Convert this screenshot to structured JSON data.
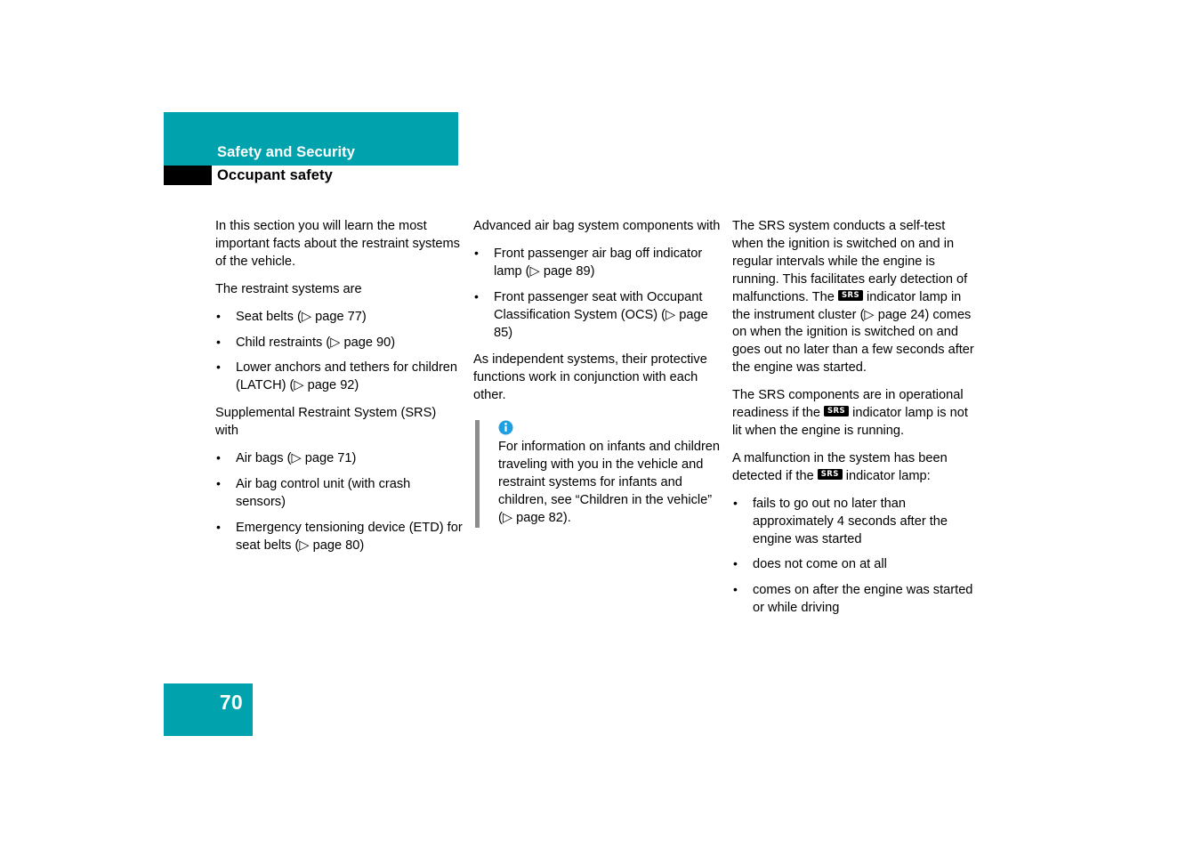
{
  "header": {
    "chapter_title": "Safety and Security",
    "section_title": "Occupant safety",
    "band_color": "#00a3ad",
    "marker_color": "#000000"
  },
  "columns": {
    "col1": {
      "intro_paragraph": "In this section you will learn the most important facts about the restraint systems of the vehicle.",
      "lead_1": "The restraint systems are",
      "list_1": [
        "Seat belts (▷ page 77)",
        "Child restraints (▷ page 90)",
        "Lower anchors and tethers for children (LATCH) (▷ page 92)"
      ],
      "lead_2": "Supplemental Restraint System (SRS) with",
      "list_2": [
        "Air bags (▷ page 71)",
        "Air bag control unit (with crash sensors)",
        "Emergency tensioning device (ETD) for seat belts (▷ page 80)"
      ]
    },
    "col2": {
      "lead_1": "Advanced air bag system components with",
      "list_1": [
        "Front passenger air bag off indicator lamp (▷ page 89)",
        "Front passenger seat with Occupant Classification System (OCS) (▷ page 85)"
      ],
      "para_1": "As independent systems, their protective functions work in conjunction with each other.",
      "note": {
        "icon": "info-circle-icon",
        "icon_color": "#1f9fe0",
        "rule_color": "#8c8c8c",
        "text": "For information on infants and children traveling with you in the vehicle and restraint systems for infants and children, see “Children in the vehicle” (▷ page 82)."
      }
    },
    "col3": {
      "para_1_a": "The SRS system conducts a self-test when the ignition is switched on and in regular intervals while the engine is running. This facilitates early detection of malfunctions. The ",
      "srs_badge": "SRS",
      "para_1_b": " indicator lamp in the instrument cluster (▷ page 24) comes on when the ignition is switched on and goes out no later than a few seconds after the engine was started.",
      "para_2_a": "The SRS components are in operational readiness if the ",
      "para_2_b": " indicator lamp is not lit when the engine is running.",
      "para_3_a": "A malfunction in the system has been detected if the ",
      "para_3_b": " indicator lamp:",
      "list_1": [
        "fails to go out no later than approximately 4 seconds after the engine was started",
        "does not come on at all",
        "comes on after the engine was started or while driving"
      ]
    }
  },
  "footer": {
    "page_number": "70",
    "block_color": "#00a3ad"
  }
}
